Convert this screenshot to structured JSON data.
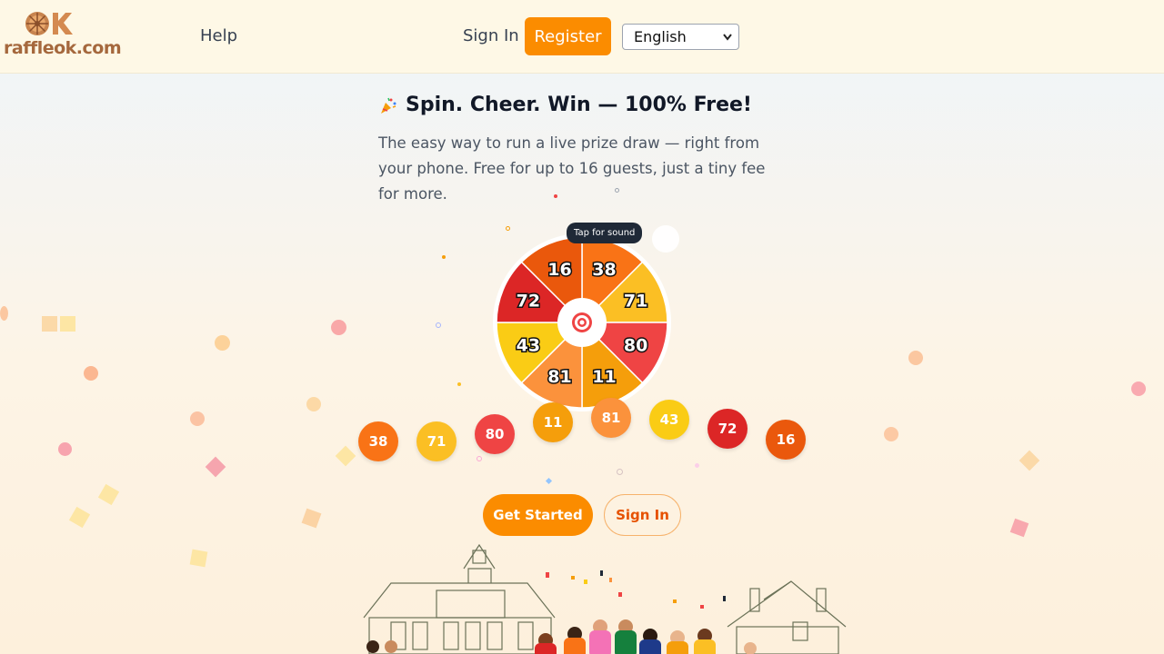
{
  "header": {
    "logo_text": "raffleok.com",
    "logo_mark": "OK",
    "nav_help": "Help",
    "nav_signin": "Sign In",
    "register_label": "Register",
    "language": "English"
  },
  "hero": {
    "title": "Spin. Cheer. Win — 100% Free!",
    "subtitle": "The easy way to run a live prize draw — right from your phone. Free for up to 16 guests, just a tiny fee for more.",
    "tooltip": "Tap for sound"
  },
  "wheel": {
    "segments": [
      {
        "label": "38",
        "color": "#f97316"
      },
      {
        "label": "71",
        "color": "#fbbf24"
      },
      {
        "label": "80",
        "color": "#ef4444"
      },
      {
        "label": "11",
        "color": "#f59e0b"
      },
      {
        "label": "81",
        "color": "#fb923c"
      },
      {
        "label": "43",
        "color": "#facc15"
      },
      {
        "label": "72",
        "color": "#dc2626"
      },
      {
        "label": "16",
        "color": "#ea580c"
      }
    ],
    "center_icon": "target-icon"
  },
  "balls": [
    {
      "label": "38",
      "color": "#f97316"
    },
    {
      "label": "71",
      "color": "#fbbf24"
    },
    {
      "label": "80",
      "color": "#ef4444"
    },
    {
      "label": "11",
      "color": "#f59e0b"
    },
    {
      "label": "81",
      "color": "#fb923c"
    },
    {
      "label": "43",
      "color": "#facc15"
    },
    {
      "label": "72",
      "color": "#dc2626"
    },
    {
      "label": "16",
      "color": "#ea580c"
    }
  ],
  "cta": {
    "get_started": "Get Started",
    "sign_in": "Sign In"
  },
  "colors": {
    "accent": "#fb8c00",
    "header_bg": "#fef8e6"
  }
}
